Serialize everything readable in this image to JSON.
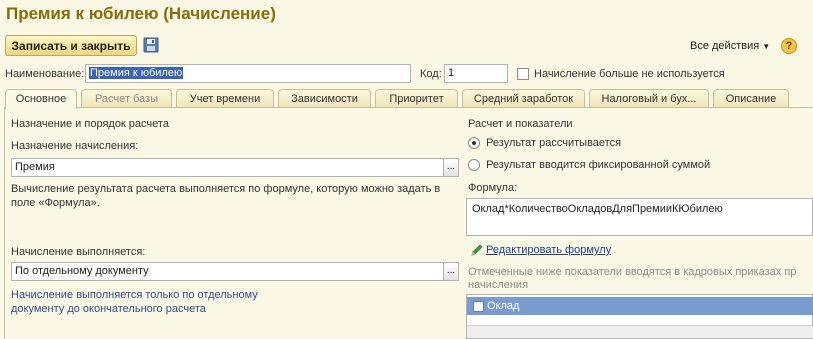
{
  "window": {
    "title": "Премия к юбилею (Начисление)"
  },
  "toolbar": {
    "save_close_label": "Записать и закрыть",
    "all_actions_label": "Все действия",
    "help_label": "?",
    "save_icon": "floppy-disk-icon"
  },
  "header": {
    "name_label": "Наименование:",
    "name_value": "Премия к юбилею",
    "code_label": "Код:",
    "code_value": "1",
    "unused_label": "Начисление больше не используется"
  },
  "tabs": [
    {
      "label": "Основное",
      "state": "active"
    },
    {
      "label": "Расчет базы",
      "state": "disabled"
    },
    {
      "label": "Учет времени",
      "state": "normal"
    },
    {
      "label": "Зависимости",
      "state": "normal"
    },
    {
      "label": "Приоритет",
      "state": "normal"
    },
    {
      "label": "Средний заработок",
      "state": "normal"
    },
    {
      "label": "Налоговый и бух...",
      "state": "normal"
    },
    {
      "label": "Описание",
      "state": "normal"
    }
  ],
  "left": {
    "section_title": "Назначение и порядок расчета",
    "purpose_label": "Назначение начисления:",
    "purpose_value": "Премия",
    "purpose_note": "Вычисление результата расчета выполняется по формуле, которую можно задать в поле «Формула».",
    "executed_label": "Начисление выполняется:",
    "executed_value": "По отдельному документу",
    "executed_note": "Начисление выполняется только по отдельному документу до окончательного расчета",
    "dots": "..."
  },
  "right": {
    "section_title": "Расчет и показатели",
    "radio_calculated": "Результат рассчитывается",
    "radio_fixed": "Результат вводится фиксированной суммой",
    "formula_label": "Формула:",
    "formula_value": "Оклад*КоличествоОкладовДляПремииКЮбилею",
    "edit_formula_link": "Редактировать формулу",
    "indicators_note": "Отмеченные ниже показатели вводятся в кадровых приказах пр начисления",
    "indicators": [
      {
        "label": "Оклад",
        "checked": false
      }
    ]
  },
  "colors": {
    "title": "#8a6b0a",
    "background": "#fbf8e6",
    "selection": "#3b64b4",
    "grid_selection": "#7a9bd0",
    "link": "#1a3e9c"
  }
}
